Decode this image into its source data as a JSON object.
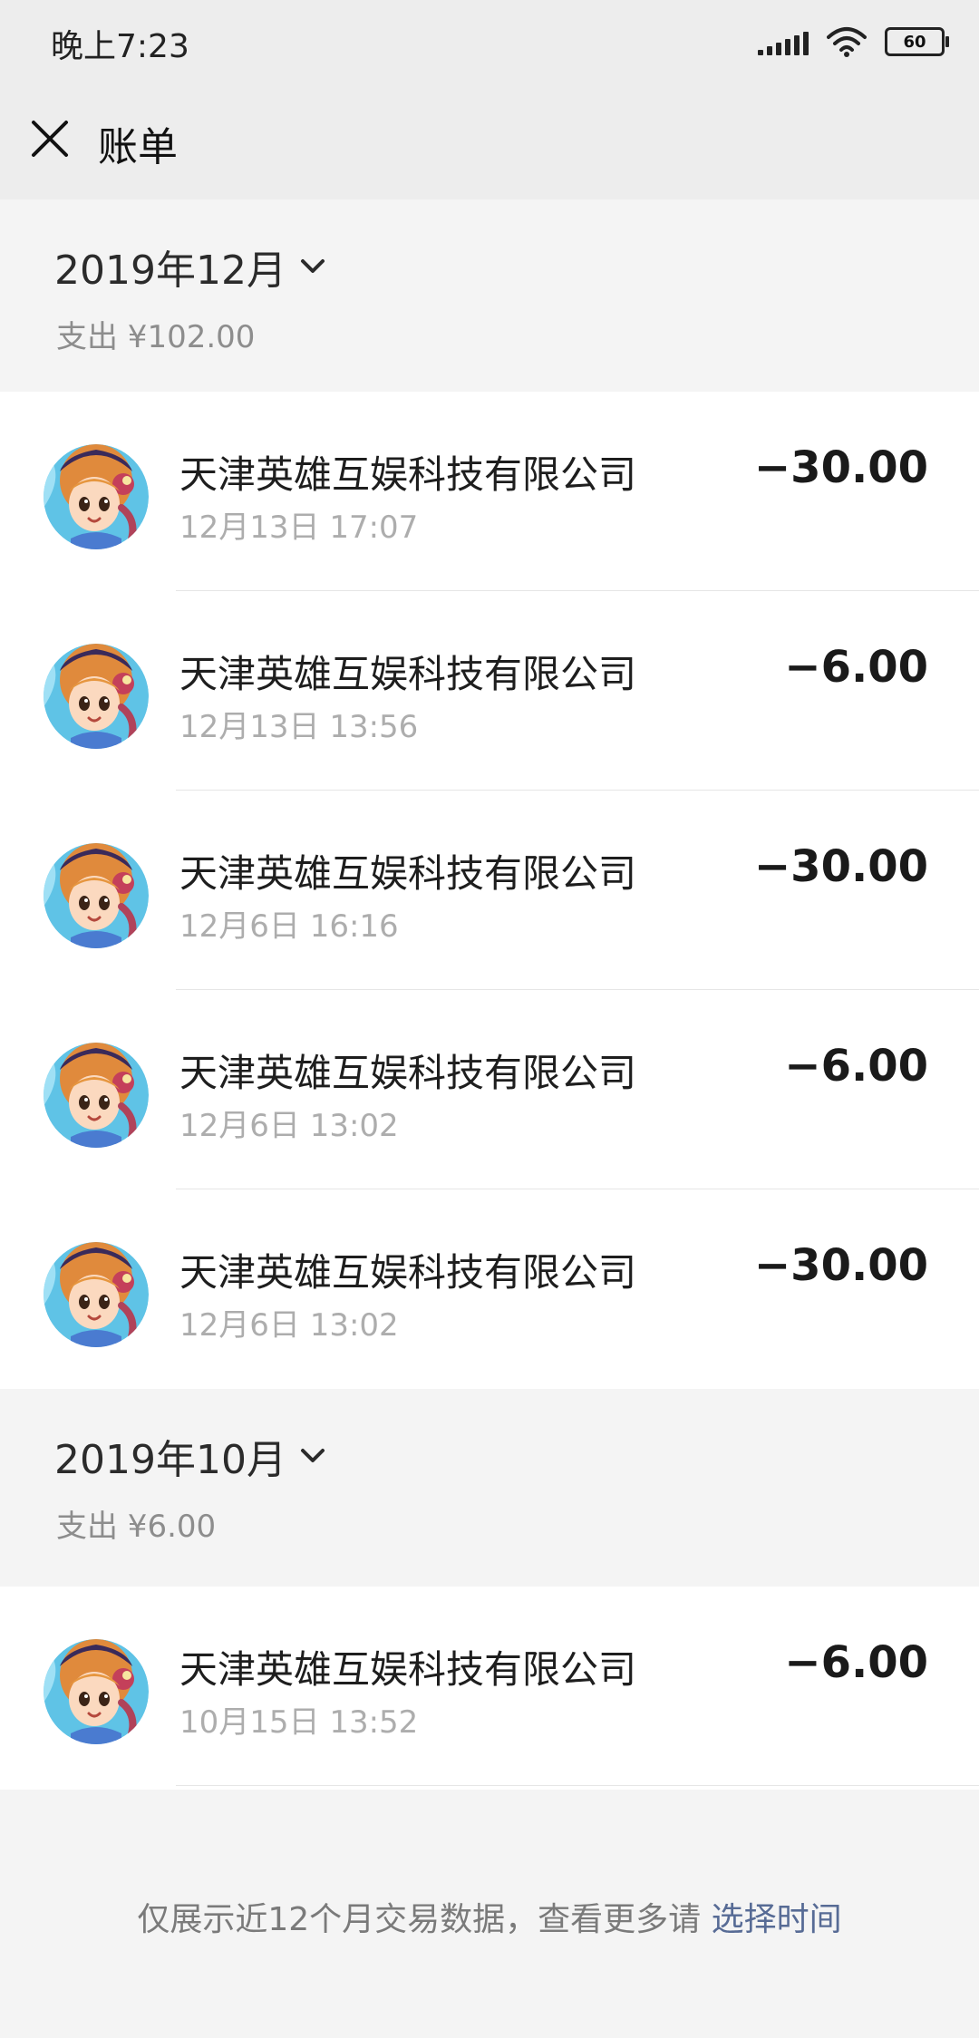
{
  "status_bar": {
    "time": "晚上7:23",
    "battery_level": "60",
    "icons": [
      "signal-icon",
      "wifi-icon",
      "battery-icon"
    ]
  },
  "nav": {
    "title": "账单",
    "close_icon": "close-icon"
  },
  "months": [
    {
      "title": "2019年12月",
      "summary": "支出 ¥102.00",
      "transactions": [
        {
          "merchant": "天津英雄互娱科技有限公司",
          "datetime": "12月13日 17:07",
          "amount": "−30.00"
        },
        {
          "merchant": "天津英雄互娱科技有限公司",
          "datetime": "12月13日 13:56",
          "amount": "−6.00"
        },
        {
          "merchant": "天津英雄互娱科技有限公司",
          "datetime": "12月6日 16:16",
          "amount": "−30.00"
        },
        {
          "merchant": "天津英雄互娱科技有限公司",
          "datetime": "12月6日 13:02",
          "amount": "−6.00"
        },
        {
          "merchant": "天津英雄互娱科技有限公司",
          "datetime": "12月6日 13:02",
          "amount": "−30.00"
        }
      ]
    },
    {
      "title": "2019年10月",
      "summary": "支出 ¥6.00",
      "transactions": [
        {
          "merchant": "天津英雄互娱科技有限公司",
          "datetime": "10月15日 13:52",
          "amount": "−6.00"
        }
      ]
    }
  ],
  "footer": {
    "note": "仅展示近12个月交易数据，查看更多请 ",
    "link": "选择时间"
  },
  "colors": {
    "page_bg": "#ededed",
    "section_bg": "#f4f4f4",
    "link": "#576b95"
  }
}
